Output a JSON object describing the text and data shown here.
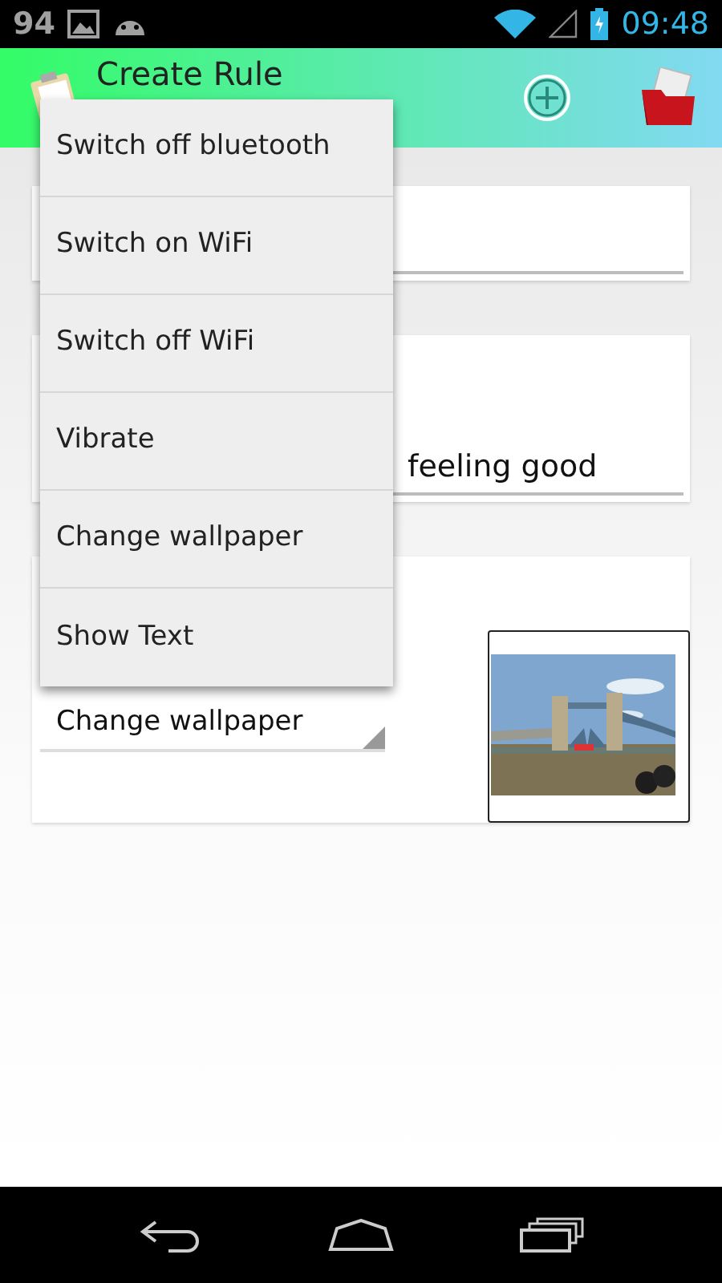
{
  "status_bar": {
    "battery_percent": "94",
    "time": "09:48"
  },
  "app_bar": {
    "title": "Create Rule"
  },
  "cards": [
    {
      "kind": "field"
    },
    {
      "kind": "field",
      "value": "feeling good"
    },
    {
      "kind": "spinner",
      "value": "Change wallpaper"
    }
  ],
  "popup_menu": {
    "items": [
      {
        "label": "Switch off bluetooth"
      },
      {
        "label": "Switch on WiFi"
      },
      {
        "label": "Switch off WiFi"
      },
      {
        "label": "Vibrate"
      },
      {
        "label": "Change wallpaper"
      },
      {
        "label": "Show Text"
      }
    ]
  }
}
